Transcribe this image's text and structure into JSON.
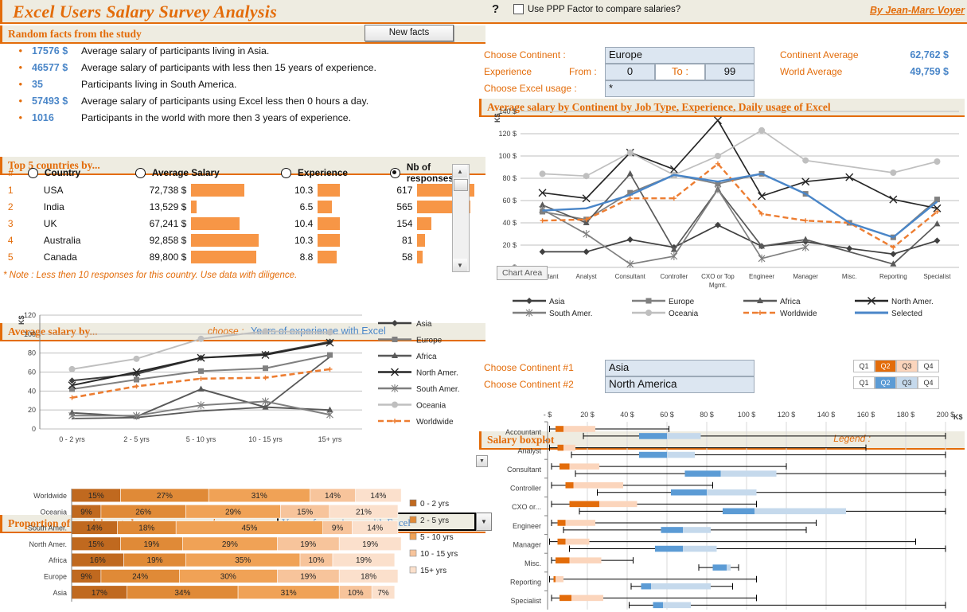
{
  "header": {
    "title": "Excel Users Salary Survey Analysis",
    "help_icon": "?",
    "ppp_label": "Use PPP Factor to compare salaries?",
    "author": "By Jean-Marc Voyer"
  },
  "facts": {
    "section_title": "Random facts from the study",
    "new_facts_button": "New facts",
    "items": [
      {
        "value": "17576 $",
        "text": "Average salary of participants living in Asia."
      },
      {
        "value": "46577 $",
        "text": "Average salary of participants with less then 15 years of experience."
      },
      {
        "value": "35",
        "text": "Participants living in South America."
      },
      {
        "value": "57493 $",
        "text": "Average salary of participants using Excel less then 0 hours a day."
      },
      {
        "value": "1016",
        "text": "Participants in the world with more then 3 years of experience."
      }
    ]
  },
  "top5": {
    "section_title": "Top 5 countries by...",
    "columns": {
      "num": "#",
      "country": "Country",
      "salary": "Average Salary",
      "experience": "Experience",
      "responses": "Nb of responses"
    },
    "selected_sort": "responses",
    "rows": [
      {
        "num": "1",
        "country": "USA",
        "salary": "72,738 $",
        "salary_pct": 78,
        "experience": "10.3",
        "exp_pct": 99,
        "responses": "617",
        "resp_pct": 100
      },
      {
        "num": "2",
        "country": "India",
        "salary": "13,529 $",
        "salary_pct": 8,
        "experience": "6.5",
        "exp_pct": 62,
        "responses": "565",
        "resp_pct": 92
      },
      {
        "num": "3",
        "country": "UK",
        "salary": "67,241 $",
        "salary_pct": 72,
        "experience": "10.4",
        "exp_pct": 100,
        "responses": "154",
        "resp_pct": 25
      },
      {
        "num": "4",
        "country": "Australia",
        "salary": "92,858 $",
        "salary_pct": 100,
        "experience": "10.3",
        "exp_pct": 99,
        "responses": "81",
        "resp_pct": 13
      },
      {
        "num": "5",
        "country": "Canada",
        "salary": "89,800 $",
        "salary_pct": 96,
        "experience": "8.8",
        "exp_pct": 85,
        "responses": "58",
        "resp_pct": 9
      }
    ],
    "note": "* Note : Less then 10 responses for this country. Use data with diligence."
  },
  "continent_panel": {
    "section_title": "Average salary by Continent by Job Type, Experience, Daily usage of Excel",
    "choose_continent_label": "Choose Continent :",
    "continent_value": "Europe",
    "experience_label": "Experience",
    "from_label": "From :",
    "from_value": "0",
    "to_label": "To :",
    "to_value": "99",
    "excel_usage_label": "Choose Excel usage  :",
    "excel_usage_value": "*",
    "continent_average_label": "Continent Average",
    "continent_average_value": "62,762  $",
    "world_average_label": "World Average",
    "world_average_value": "49,759  $",
    "chart_area_tooltip": "Chart Area"
  },
  "avg_salary_panel": {
    "section_title": "Average salary by...",
    "choose_label": "choose :",
    "choose_value": "Years of experience with Excel"
  },
  "proportion_panel": {
    "section_title": "Proportion of participants by...",
    "choose_label": "choose :",
    "choose_value": "Years of experience with Excel",
    "dropdown_arrow": "▼"
  },
  "boxplot_panel": {
    "section_title": "Salary boxplot",
    "legend_label": "Legend :",
    "continent1_label": "Choose Continent #1",
    "continent1_value": "Asia",
    "continent2_label": "Choose Continent #2",
    "continent2_value": "North America",
    "quartiles": [
      "Q1",
      "Q2",
      "Q3",
      "Q4"
    ],
    "axis_unit": "K$"
  },
  "colors": {
    "accent_orange": "#E36C0A",
    "bar_orange": "#F79646",
    "blue_value": "#4A86C8",
    "header_bg": "#EEECE1",
    "field_bg": "#DCE6F1",
    "series_worldwide": "#ED7D31",
    "series_selected": "#4A86C8",
    "q2_orange": "#E36C0A",
    "q3_orange": "#FBD5BC",
    "q2_blue": "#5B9BD5",
    "q3_blue": "#C5D9EC"
  },
  "chart_data": [
    {
      "id": "salary_by_jobtype",
      "type": "line",
      "title": "Average salary by Continent by Job Type",
      "ylabel": "K$",
      "ylim": [
        0,
        140
      ],
      "yticks": [
        "-  $",
        "20 $",
        "40 $",
        "60 $",
        "80 $",
        "100 $",
        "120 $",
        "140 $"
      ],
      "categories": [
        "Accountant",
        "Analyst",
        "Consultant",
        "Controller",
        "CXO or Top Mgmt.",
        "Engineer",
        "Manager",
        "Misc.",
        "Reporting",
        "Specialist"
      ],
      "legend_position": "bottom",
      "series": [
        {
          "name": "Asia",
          "marker": "diamond",
          "color": "#404040",
          "values": [
            14,
            14,
            25,
            18,
            38,
            19,
            23,
            17,
            12,
            24
          ]
        },
        {
          "name": "Europe",
          "marker": "square",
          "color": "#808080",
          "values": [
            50,
            43,
            67,
            83,
            75,
            84,
            66,
            40,
            27,
            61
          ]
        },
        {
          "name": "Africa",
          "marker": "triangle",
          "color": "#595959",
          "values": [
            56,
            40,
            84,
            16,
            70,
            19,
            25,
            null,
            3,
            39
          ]
        },
        {
          "name": "North Amer.",
          "marker": "cross",
          "color": "#262626",
          "values": [
            67,
            62,
            103,
            88,
            132,
            64,
            77,
            81,
            61,
            53
          ]
        },
        {
          "name": "South Amer.",
          "marker": "star",
          "color": "#7F7F7F",
          "values": [
            52,
            30,
            3,
            10,
            70,
            8,
            18,
            null,
            null,
            null
          ]
        },
        {
          "name": "Oceania",
          "marker": "circle",
          "color": "#BFBFBF",
          "values": [
            84,
            82,
            103,
            83,
            100,
            123,
            96,
            null,
            85,
            95
          ]
        },
        {
          "name": "Worldwide",
          "marker": "dashed",
          "color": "#ED7D31",
          "values": [
            42,
            43,
            62,
            62,
            93,
            48,
            42,
            40,
            18,
            50
          ]
        },
        {
          "name": "Selected",
          "marker": "plain",
          "color": "#4A86C8",
          "values": [
            51,
            53,
            65,
            83,
            77,
            84,
            66,
            40,
            27,
            59
          ]
        }
      ]
    },
    {
      "id": "avg_salary_by_experience",
      "type": "line",
      "title": "Average salary by...",
      "ylabel": "K$",
      "ylim": [
        0,
        120
      ],
      "yticks": [
        "0",
        "20",
        "40",
        "60",
        "80",
        "100",
        "120"
      ],
      "categories": [
        "0 - 2 yrs",
        "2 - 5 yrs",
        "5 - 10 yrs",
        "10 - 15 yrs",
        "15+ yrs"
      ],
      "legend_position": "right",
      "series": [
        {
          "name": "Asia",
          "marker": "diamond",
          "color": "#404040",
          "values": [
            51,
            58,
            75,
            79,
            92
          ]
        },
        {
          "name": "Europe",
          "marker": "square",
          "color": "#808080",
          "values": [
            42,
            52,
            61,
            64,
            78
          ]
        },
        {
          "name": "Africa",
          "marker": "triangle",
          "color": "#595959",
          "values": [
            17,
            13,
            42,
            23,
            20
          ]
        },
        {
          "name": "North Amer.",
          "marker": "cross",
          "color": "#262626",
          "values": [
            46,
            60,
            75,
            78,
            91
          ]
        },
        {
          "name": "South Amer.",
          "marker": "star",
          "color": "#7F7F7F",
          "values": [
            14,
            14,
            25,
            29,
            15
          ]
        },
        {
          "name": "Oceania",
          "marker": "circle",
          "color": "#BFBFBF",
          "values": [
            63,
            74,
            95,
            103,
            102
          ]
        },
        {
          "name": "Worldwide",
          "marker": "dashed",
          "color": "#ED7D31",
          "values": [
            33,
            45,
            53,
            54,
            63
          ]
        }
      ],
      "extra_series": [
        {
          "name": "low-grey",
          "color": "#595959",
          "values": [
            11,
            12,
            19,
            23,
            76
          ]
        }
      ]
    },
    {
      "id": "proportion_by_experience",
      "type": "bar",
      "orientation": "horizontal-stacked",
      "title": "Proportion of participants by...",
      "categories": [
        "Worldwide",
        "Oceania",
        "South Amer.",
        "North Amer.",
        "Africa",
        "Europe",
        "Asia"
      ],
      "legend": [
        "0 - 2 yrs",
        "2 - 5 yrs",
        "5 - 10 yrs",
        "10 - 15 yrs",
        "15+ yrs"
      ],
      "legend_colors": [
        "#C0691F",
        "#E08A37",
        "#F0A256",
        "#F7C49B",
        "#FBE0CC"
      ],
      "rows": [
        {
          "name": "Worldwide",
          "values": [
            15,
            27,
            31,
            14,
            14
          ],
          "labels": [
            "15%",
            "27%",
            "31%",
            "14%",
            "14%"
          ]
        },
        {
          "name": "Oceania",
          "values": [
            9,
            26,
            29,
            15,
            21
          ],
          "labels": [
            "9%",
            "26%",
            "29%",
            "15%",
            "21%"
          ]
        },
        {
          "name": "South Amer.",
          "values": [
            14,
            18,
            45,
            9,
            14
          ],
          "labels": [
            "14%",
            "18%",
            "45%",
            "9%",
            "14%"
          ]
        },
        {
          "name": "North Amer.",
          "values": [
            15,
            19,
            29,
            19,
            19
          ],
          "labels": [
            "15%",
            "19%",
            "29%",
            "19%",
            "19%"
          ]
        },
        {
          "name": "Africa",
          "values": [
            16,
            19,
            35,
            10,
            19
          ],
          "labels": [
            "16%",
            "19%",
            "35%",
            "10%",
            "19%"
          ]
        },
        {
          "name": "Europe",
          "values": [
            9,
            24,
            30,
            19,
            18
          ],
          "labels": [
            "9%",
            "24%",
            "30%",
            "19%",
            "18%"
          ]
        },
        {
          "name": "Asia",
          "values": [
            17,
            34,
            31,
            10,
            7
          ],
          "labels": [
            "17%",
            "34%",
            "31%",
            "10%",
            "7%"
          ]
        }
      ]
    },
    {
      "id": "salary_boxplot",
      "type": "box",
      "title": "Salary boxplot",
      "xlabel": "K$",
      "xlim": [
        0,
        200
      ],
      "xticks": [
        "-  $",
        "20 $",
        "40 $",
        "60 $",
        "80 $",
        "100 $",
        "120 $",
        "140 $",
        "160 $",
        "180 $",
        "200 $"
      ],
      "categories": [
        "Accountant",
        "Analyst",
        "Consultant",
        "Controller",
        "CXO or...",
        "Engineer",
        "Manager",
        "Misc.",
        "Reporting",
        "Specialist"
      ],
      "series": [
        {
          "name": "Asia",
          "color_q2": "#E36C0A",
          "color_q3": "#FBD5BC",
          "boxes": [
            {
              "min": 1,
              "q1": 4,
              "med": 8,
              "q3": 24,
              "max": 61
            },
            {
              "min": 1,
              "q1": 5,
              "med": 8,
              "q3": 14,
              "max": 160
            },
            {
              "min": 2,
              "q1": 6,
              "med": 11,
              "q3": 26,
              "max": 120
            },
            {
              "min": 2,
              "q1": 9,
              "med": 13,
              "q3": 38,
              "max": 83
            },
            {
              "min": 2,
              "q1": 11,
              "med": 26,
              "q3": 45,
              "max": 105
            },
            {
              "min": 2,
              "q1": 5,
              "med": 9,
              "q3": 24,
              "max": 135
            },
            {
              "min": 1,
              "q1": 5,
              "med": 9,
              "q3": 21,
              "max": 185
            },
            {
              "min": 2,
              "q1": 4,
              "med": 11,
              "q3": 27,
              "max": 43
            },
            {
              "min": 1,
              "q1": 3,
              "med": 4,
              "q3": 8,
              "max": 105
            },
            {
              "min": 2,
              "q1": 6,
              "med": 12,
              "q3": 28,
              "max": 105
            }
          ]
        },
        {
          "name": "North America",
          "color_q2": "#5B9BD5",
          "color_q3": "#C5D9EC",
          "boxes": [
            {
              "min": 18,
              "q1": 46,
              "med": 60,
              "q3": 77,
              "max": 200
            },
            {
              "min": 12,
              "q1": 46,
              "med": 60,
              "q3": 74,
              "max": 200
            },
            {
              "min": 14,
              "q1": 69,
              "med": 87,
              "q3": 115,
              "max": 200
            },
            {
              "min": 25,
              "q1": 62,
              "med": 80,
              "q3": 105,
              "max": 200
            },
            {
              "min": 16,
              "q1": 88,
              "med": 104,
              "q3": 150,
              "max": 200
            },
            {
              "min": 8,
              "q1": 57,
              "med": 68,
              "q3": 82,
              "max": 130
            },
            {
              "min": 11,
              "q1": 54,
              "med": 68,
              "q3": 85,
              "max": 200
            },
            {
              "min": 76,
              "q1": 83,
              "med": 90,
              "q3": 92,
              "max": 96
            },
            {
              "min": 42,
              "q1": 47,
              "med": 52,
              "q3": 82,
              "max": 93
            },
            {
              "min": 41,
              "q1": 53,
              "med": 58,
              "q3": 72,
              "max": 200
            }
          ]
        }
      ]
    }
  ]
}
